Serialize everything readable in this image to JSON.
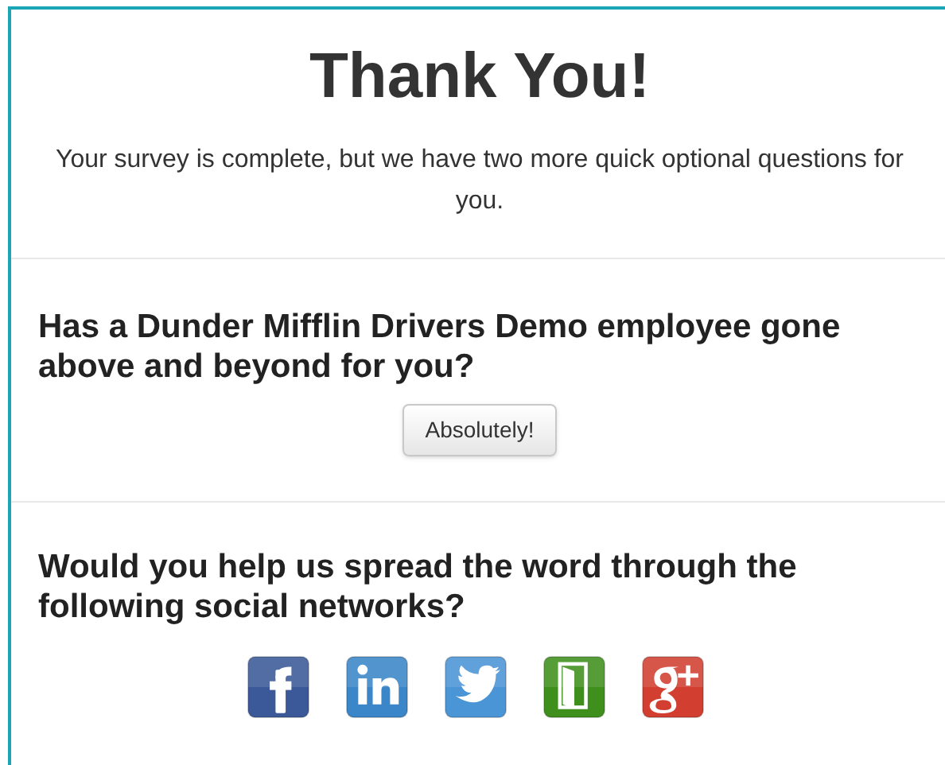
{
  "title": "Thank You!",
  "intro": "Your survey is complete, but we have two more quick optional questions for you.",
  "questions": [
    {
      "text": "Has a Dunder Mifflin Drivers Demo employee gone above and beyond for you?",
      "button": "Absolutely!"
    },
    {
      "text": "Would you help us spread the word through the following social networks?",
      "networks": [
        {
          "kind": "facebook"
        },
        {
          "kind": "linkedin"
        },
        {
          "kind": "twitter"
        },
        {
          "kind": "door"
        },
        {
          "kind": "gplus"
        }
      ]
    }
  ]
}
